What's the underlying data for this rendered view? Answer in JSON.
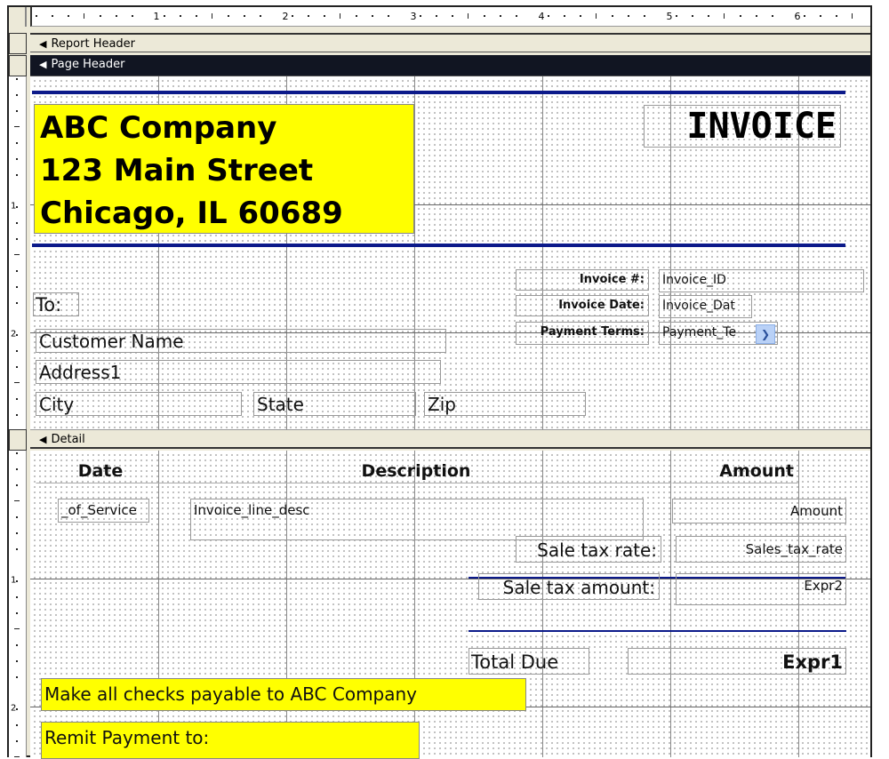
{
  "ruler": {
    "top_numbers": [
      "1",
      "2",
      "3",
      "4",
      "5",
      "6"
    ],
    "left_numbers_page_header": [
      "1",
      "2"
    ],
    "left_numbers_detail": [
      "1",
      "2"
    ]
  },
  "sections": {
    "report_header": "Report Header",
    "page_header": "Page Header",
    "detail": "Detail"
  },
  "page_header": {
    "company_lines": [
      "ABC Company",
      "123 Main Street",
      "Chicago, IL 60689"
    ],
    "invoice_title": "INVOICE",
    "to_label": "To:",
    "customer_name": "Customer  Name",
    "address1": "Address1",
    "city": "City",
    "state": "State",
    "zip": "Zip",
    "invoice_number_label": "Invoice #:",
    "invoice_number_field": "Invoice_ID",
    "invoice_date_label": "Invoice Date:",
    "invoice_date_field": "Invoice_Dat",
    "payment_terms_label": "Payment Terms:",
    "payment_terms_field": "Payment_Te",
    "dropdown_icon": "chevron-down-icon"
  },
  "detail": {
    "headers": {
      "date": "Date",
      "description": "Description",
      "amount": "Amount"
    },
    "date_field": "_of_Service",
    "description_field": "Invoice_line_desc",
    "amount_field": "Amount",
    "sale_tax_rate_label": "Sale tax rate:",
    "sales_tax_rate_field": "Sales_tax_rate",
    "sale_tax_amount_label": "Sale tax amount:",
    "expr2_field": "Expr2",
    "total_due_label": "Total Due",
    "expr1_field": "Expr1",
    "checks_payable_note": "Make all checks payable to ABC Company",
    "remit_payment_label": "Remit Payment to:"
  },
  "colors": {
    "highlight_yellow": "#ffff00",
    "rule_blue": "#0c1a8a",
    "page_header_band": "#111522",
    "section_band": "#ece9d8"
  }
}
